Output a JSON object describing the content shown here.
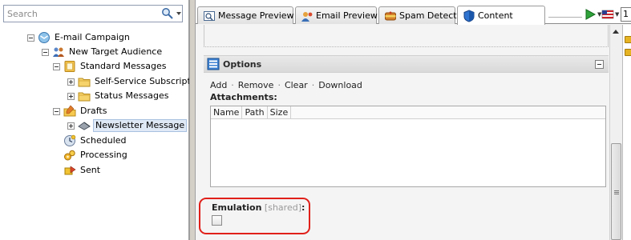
{
  "search": {
    "placeholder": "Search"
  },
  "tree": [
    {
      "label": "E-mail Campaign",
      "icon": "email-campaign-icon",
      "toggle": "minus",
      "level": 0
    },
    {
      "label": "New Target Audience",
      "icon": "audience-icon",
      "toggle": "minus",
      "level": 1
    },
    {
      "label": "Standard Messages",
      "icon": "message-folder-icon",
      "toggle": "minus",
      "level": 2
    },
    {
      "label": "Self-Service Subscription",
      "icon": "folder-icon",
      "toggle": "plus",
      "level": 3
    },
    {
      "label": "Status Messages",
      "icon": "folder-icon",
      "toggle": "plus",
      "level": 3
    },
    {
      "label": "Drafts",
      "icon": "drafts-icon",
      "toggle": "minus",
      "level": 2
    },
    {
      "label": "Newsletter Message",
      "icon": "newsletter-icon",
      "toggle": "plus",
      "level": 3,
      "selected": true
    },
    {
      "label": "Scheduled",
      "icon": "scheduled-icon",
      "toggle": "none",
      "level": 2
    },
    {
      "label": "Processing",
      "icon": "processing-icon",
      "toggle": "none",
      "level": 2
    },
    {
      "label": "Sent",
      "icon": "sent-icon",
      "toggle": "none",
      "level": 2
    }
  ],
  "tabs": [
    {
      "label": "Message Preview",
      "icon": "preview-icon",
      "active": false
    },
    {
      "label": "Email Preview",
      "icon": "email-preview-icon",
      "active": false
    },
    {
      "label": "Spam Detect",
      "icon": "spam-detect-icon",
      "active": false
    },
    {
      "label": "Content",
      "icon": "content-icon",
      "active": true
    }
  ],
  "toolbar": {
    "number_value": "1"
  },
  "options": {
    "title": "Options",
    "actions": [
      "Add",
      "Remove",
      "Clear",
      "Download"
    ],
    "separator": "·",
    "attachments_label": "Attachments:",
    "columns": [
      "Name",
      "Path",
      "Size"
    ]
  },
  "emulation": {
    "label": "Emulation",
    "shared": "[shared]",
    "colon": ":",
    "checked": false
  },
  "colors": {
    "highlight": "#e0201a",
    "folder": "#e6b422",
    "selection": "#dfe9f5"
  }
}
